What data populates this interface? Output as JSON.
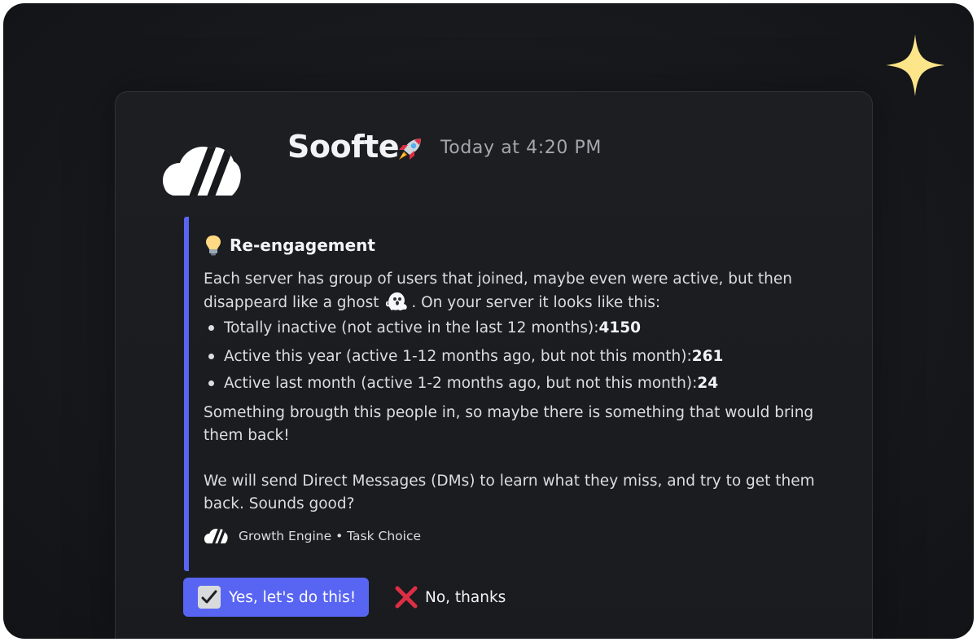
{
  "message": {
    "author": "Soofte",
    "timestamp": "Today at 4:20 PM"
  },
  "embed": {
    "title": "Re-engagement",
    "intro_line1": "Each server has group of users that joined, maybe even were active, but then",
    "intro_line2_before": "disappeard like a ghost",
    "intro_line2_after": ". On your server it looks like this:",
    "bullets": [
      {
        "text": "Totally inactive (not active in the last 12 months): ",
        "value": "4150"
      },
      {
        "text": "Active this year (active 1-12 months ago, but not this month): ",
        "value": "261"
      },
      {
        "text": "Active last month (active 1-2 months ago, but not this month): ",
        "value": "24"
      }
    ],
    "para2_line1": "Something brougth this people in, so maybe there is something that would bring",
    "para2_line2": "them back!",
    "para3_line1": "We will send Direct Messages (DMs) to learn what they miss, and try to get them",
    "para3_line2": "back. Sounds good?",
    "footer": "Growth Engine • Task Choice"
  },
  "buttons": {
    "yes_label": "Yes, let's do this!",
    "no_label": "No, thanks"
  },
  "colors": {
    "accent": "#5865f2",
    "background": "#17191d",
    "sparkle": "#fde68a",
    "no_icon": "#dd2e44"
  },
  "icons": [
    "sparkle-icon",
    "app-logo-icon",
    "rocket-icon",
    "lightbulb-icon",
    "ghost-icon",
    "check-icon",
    "cross-icon"
  ]
}
